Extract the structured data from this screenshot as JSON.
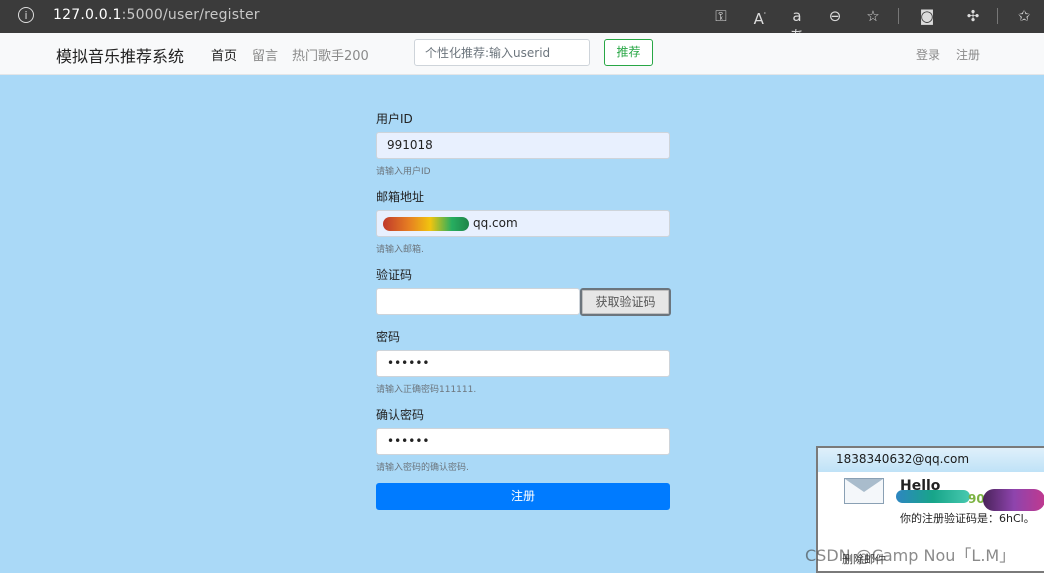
{
  "browser": {
    "url_host": "127.0.0.1",
    "url_path": ":5000/user/register",
    "icons": [
      "info-icon",
      "key-icon",
      "read-aloud-icon",
      "translate-icon",
      "zoom-out-icon",
      "add-favorite-icon",
      "profile-icon",
      "extensions-icon",
      "favorites-icon"
    ]
  },
  "navbar": {
    "brand": "模拟音乐推荐系统",
    "links": [
      "首页",
      "留言",
      "热门歌手200"
    ],
    "search_placeholder": "个性化推荐:输入userid",
    "recommend_button": "推荐",
    "login": "登录",
    "register": "注册"
  },
  "form": {
    "userid_label": "用户ID",
    "userid_value": "991018",
    "userid_help": "请输入用户ID",
    "email_label": "邮箱地址",
    "email_value": "qq.com",
    "email_help": "请输入邮箱.",
    "code_label": "验证码",
    "code_value": "",
    "get_code_button": "获取验证码",
    "password_label": "密码",
    "password_value": "••••••",
    "password_help": "请输入正确密码111111.",
    "confirm_label": "确认密码",
    "confirm_value": "••••••",
    "confirm_help": "请输入密码的确认密码.",
    "submit_button": "注册"
  },
  "popup": {
    "from": "1838340632@qq.com",
    "hello": "Hello",
    "partial_number": "90",
    "message": "你的注册验证码是：6hCl。",
    "delete": "删除邮件"
  },
  "watermark": "CSDN @Camp Nou「L.M」",
  "colors": {
    "page_bg": "#aad9f7",
    "primary": "#007bff",
    "success": "#28a745"
  }
}
